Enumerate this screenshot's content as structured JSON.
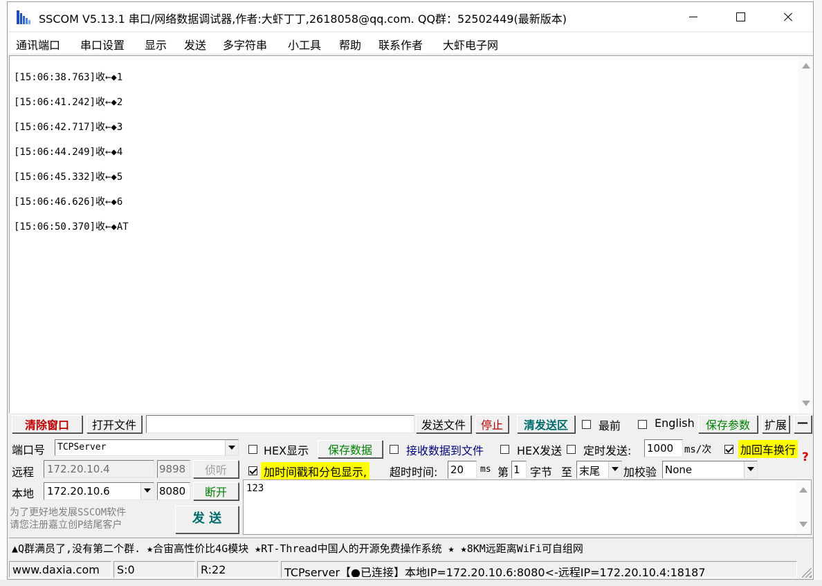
{
  "window": {
    "title": "SSCOM V5.13.1 串口/网络数据调试器,作者:大虾丁丁,2618058@qq.com. QQ群：52502449(最新版本)"
  },
  "menu": [
    "通讯端口",
    "串口设置",
    "显示",
    "发送",
    "多字符串",
    "小工具",
    "帮助",
    "联系作者",
    "大虾电子网"
  ],
  "receive": {
    "lines": [
      "[15:06:38.763]收←◆1",
      "[15:06:41.242]收←◆2",
      "[15:06:42.717]收←◆3",
      "[15:06:44.249]收←◆4",
      "[15:06:45.332]收←◆5",
      "[15:06:46.626]收←◆6",
      "[15:06:50.370]收←◆AT"
    ]
  },
  "toolbar": {
    "clear_window": "清除窗口",
    "open_file": "打开文件",
    "file_path": "",
    "send_file": "发送文件",
    "stop": "停止",
    "clear_send": "清发送区",
    "topmost": "最前",
    "english": "English",
    "save_params": "保存参数",
    "expand": "扩展",
    "collapse": "—"
  },
  "port": {
    "port_label": "端口号",
    "port_value": "TCPServer",
    "remote_label": "远程",
    "remote_ip": "172.20.10.4",
    "remote_port": "9898",
    "listen_btn": "侦听",
    "local_label": "本地",
    "local_ip": "172.20.10.6",
    "local_port": "8080",
    "disconnect_btn": "断开",
    "promo_line1": "为了更好地发展SSCOM软件",
    "promo_line2": "请您注册嘉立创P结尾客户",
    "send_btn": "发 送"
  },
  "options": {
    "hex_display": "HEX显示",
    "save_data": "保存数据",
    "recv_to_file": "接收数据到文件",
    "hex_send": "HEX发送",
    "timed_send": "定时发送:",
    "interval": "1000",
    "interval_unit": "ms/次",
    "add_crlf": "加回车换行",
    "timestamp": "加时间戳和分包显示,",
    "timeout_label": "超时时间:",
    "timeout": "20",
    "timeout_unit": "ms",
    "byte_prefix": "第",
    "byte_index": "1",
    "byte_label": "字节",
    "to_label": "至",
    "end_value": "末尾",
    "checksum_label": "加校验",
    "checksum_value": "None",
    "help": "?"
  },
  "send": {
    "text": "123"
  },
  "ticker": {
    "text": "▲Q群满员了,没有第二个群. ★合宙高性价比4G模块 ★RT-Thread中国人的开源免费操作系统 ★ ★8KM远距离WiFi可自组网"
  },
  "status": {
    "site": "www.daxia.com",
    "sent": "S:0",
    "received": "R:22",
    "connection": "TCPserver【●已连接】本地IP=172.20.10.6:8080<-远程IP=172.20.10.4:18187"
  }
}
